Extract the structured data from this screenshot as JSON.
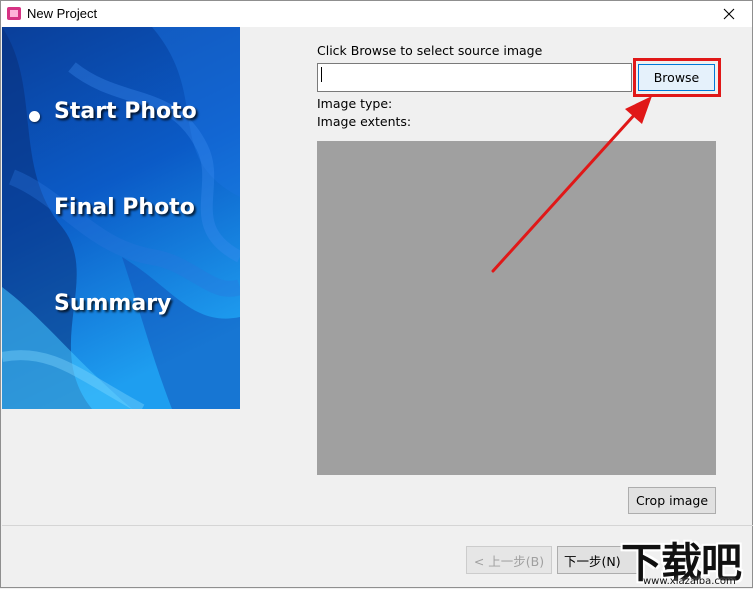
{
  "window": {
    "title": "New Project"
  },
  "sidebar": {
    "steps": [
      {
        "label": "Start Photo",
        "active": true
      },
      {
        "label": "Final Photo",
        "active": false
      },
      {
        "label": "Summary",
        "active": false
      }
    ]
  },
  "source": {
    "instruction": "Click Browse to select source image",
    "path_value": "",
    "browse_label": "Browse",
    "image_type_label": "Image type:",
    "image_extents_label": "Image extents:",
    "crop_label": "Crop image"
  },
  "footer": {
    "back_label": "< 上一步(B)",
    "next_label": "下一步(N)"
  },
  "watermark": {
    "text": "下载吧",
    "url": "www.xiazaiba.com"
  },
  "colors": {
    "highlight": "#e01818",
    "sidebar_blue": "#0d4fa8",
    "preview_gray": "#a0a0a0"
  }
}
